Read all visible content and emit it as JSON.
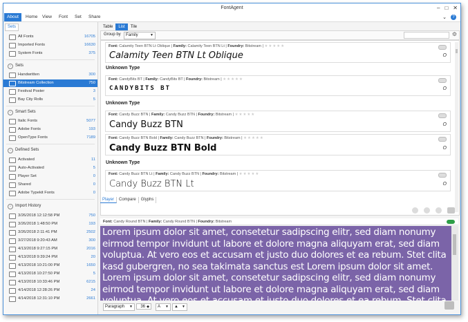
{
  "window": {
    "title": "FontAgent"
  },
  "menu": {
    "items": [
      {
        "label": "About",
        "active": true
      },
      {
        "label": "Home"
      },
      {
        "label": "View"
      },
      {
        "label": "Font"
      },
      {
        "label": "Set"
      },
      {
        "label": "Share"
      }
    ]
  },
  "sidebar": {
    "tab": "Sets",
    "library": [
      {
        "label": "All Fonts",
        "count": "16705"
      },
      {
        "label": "Imported Fonts",
        "count": "16630"
      },
      {
        "label": "System Fonts",
        "count": "375"
      }
    ],
    "sets_header": "Sets",
    "sets": [
      {
        "label": "Handwritten",
        "count": "300"
      },
      {
        "label": "Bitstream Collection",
        "count": "750",
        "selected": true
      },
      {
        "label": "Festival Poster",
        "count": "3"
      },
      {
        "label": "Bay City Rolls",
        "count": "5"
      }
    ],
    "smart_header": "Smart Sets",
    "smart_sets": [
      {
        "label": "Italic Fonts",
        "count": "5077"
      },
      {
        "label": "Adobe Fonts",
        "count": "193"
      },
      {
        "label": "OpenType Fonts",
        "count": "7189"
      }
    ],
    "defined_header": "Defined Sets",
    "defined_sets": [
      {
        "label": "Activated",
        "count": "11"
      },
      {
        "label": "Auto-Activated",
        "count": "5"
      },
      {
        "label": "Player Set",
        "count": "0"
      },
      {
        "label": "Shared",
        "count": "0"
      },
      {
        "label": "Adobe Typekit Fonts",
        "count": "0"
      }
    ],
    "import_header": "Import History",
    "imports": [
      {
        "label": "3/26/2018 12:12:58 PM",
        "count": "750"
      },
      {
        "label": "3/26/2018 1:48:50 PM",
        "count": "193"
      },
      {
        "label": "3/26/2018 2:11:41 PM",
        "count": "2502"
      },
      {
        "label": "3/27/2018 9:20:43 AM",
        "count": "300"
      },
      {
        "label": "4/13/2018 9:27:15 PM",
        "count": "2016"
      },
      {
        "label": "4/13/2018 9:39:24 PM",
        "count": "20"
      },
      {
        "label": "4/13/2018 10:21:00 PM",
        "count": "1650"
      },
      {
        "label": "4/13/2018 10:27:50 PM",
        "count": "5"
      },
      {
        "label": "4/13/2018 10:33:46 PM",
        "count": "6215"
      },
      {
        "label": "4/14/2018 12:28:26 PM",
        "count": "24"
      },
      {
        "label": "4/14/2018 12:31:10 PM",
        "count": "2661"
      }
    ]
  },
  "main": {
    "view_tabs": [
      "Table",
      "List",
      "Tile"
    ],
    "group_by_label": "Group by",
    "group_by_value": "Family",
    "group_header": "Unknown Type",
    "stars": "★★★★★",
    "cards": [
      {
        "font": "Calamity Teen BTN Lt Oblique",
        "family": "Calamity Teen BTN Lt",
        "foundry": "Bitstream",
        "sample": "Calamity Teen BTN Lt Oblique",
        "otype": "O"
      },
      {
        "font": "CandyBits BT",
        "family": "CandyBits BT",
        "foundry": "Bitstream",
        "sample": "CANDYBITS BT",
        "otype": "O"
      },
      {
        "font": "Candy Buzz BTN",
        "family": "Candy Buzz BTN",
        "foundry": "Bitstream",
        "sample": "Candy Buzz BTN",
        "otype": "O"
      },
      {
        "font": "Candy Buzz BTN Bold",
        "family": "Candy Buzz BTN",
        "foundry": "Bitstream",
        "sample": "Candy Buzz BTN Bold",
        "otype": "O"
      },
      {
        "font": "Candy Buzz BTN Lt",
        "family": "Candy Buzz BTN",
        "foundry": "Bitstream",
        "sample": "Candy Buzz BTN Lt",
        "otype": "O"
      }
    ],
    "labels": {
      "font": "Font:",
      "family": "Family:",
      "foundry": "Foundry:"
    },
    "player_tabs": [
      "Player",
      "Compare",
      "Glyphs"
    ],
    "player": {
      "font": "Candy Round BTN",
      "family": "Candy Round BTN",
      "foundry": "Bitstream",
      "preview_text": "Lorem ipsum dolor sit amet, consetetur sadipscing elitr, sed diam nonumy eirmod tempor invidunt ut labore et dolore magna aliquyam erat, sed diam voluptua. At vero eos et accusam et justo duo dolores et ea rebum. Stet clita kasd gubergren, no sea takimata sanctus est Lorem ipsum dolor sit amet. Lorem ipsum dolor sit amet, consetetur sadipscing elitr, sed diam nonumy eirmod tempor invidunt ut labore et dolore magna aliquyam erat, sed diam voluptua. At vero eos et accusam et justo duo dolores et ea rebum. Stet clita kasd gubergren, no sea takimata sanctus est Lorem ipsum dolor sit amet.",
      "paragraph": "Paragraph",
      "size": "36",
      "text_style": "A"
    }
  },
  "colors": {
    "accent": "#2a7ad4",
    "preview_bg": "#7b64a8",
    "toggle_on": "#2e9e48"
  }
}
